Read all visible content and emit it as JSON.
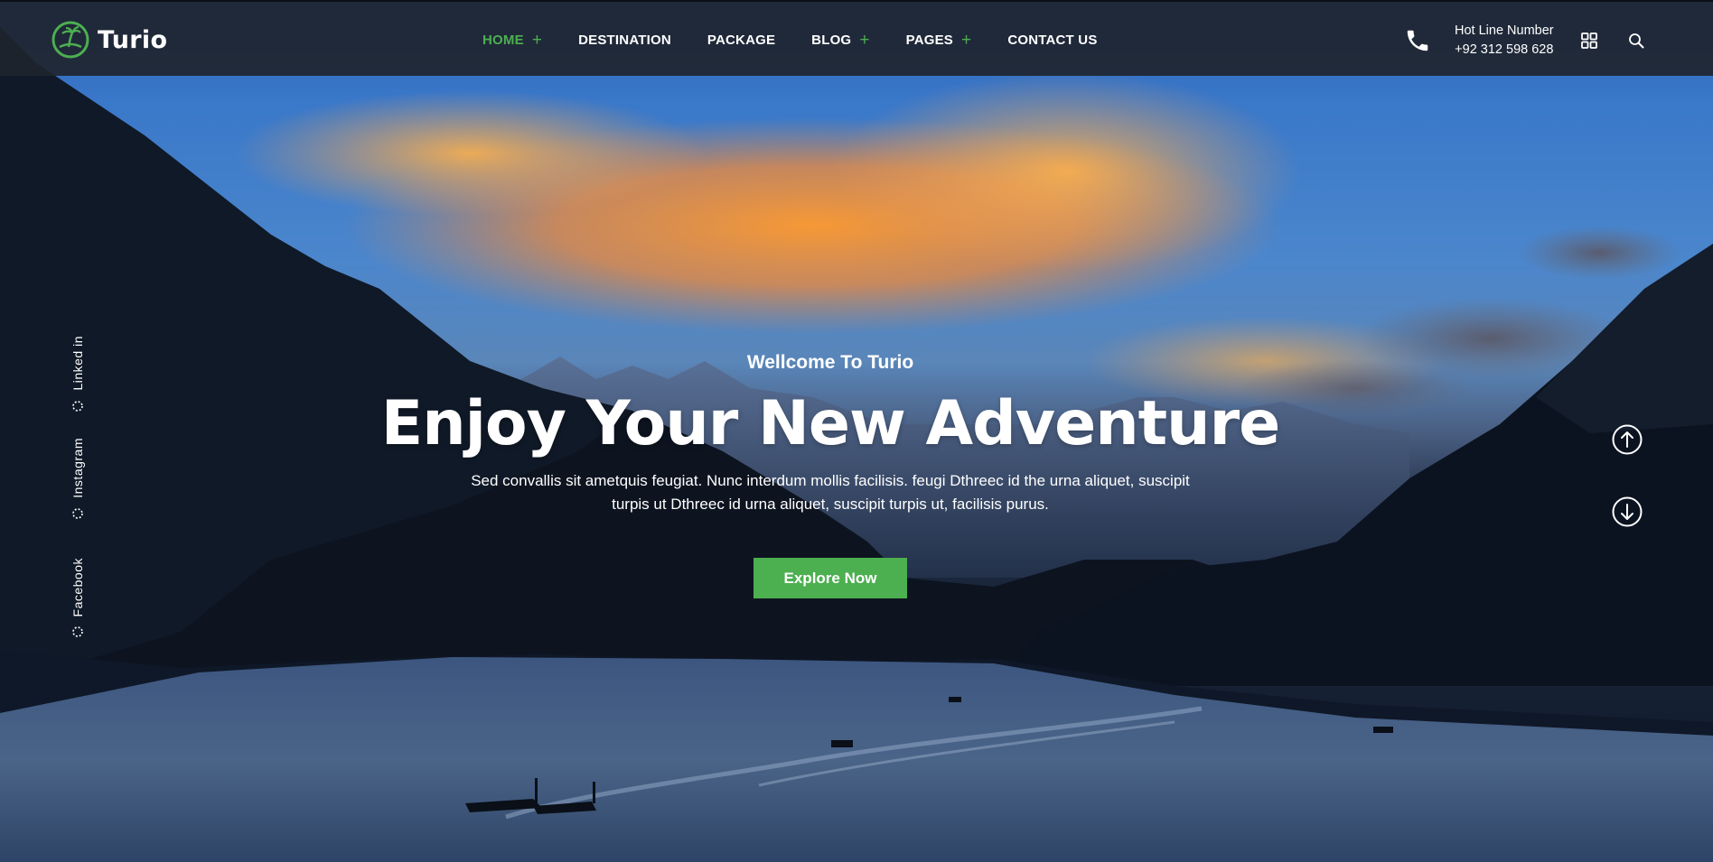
{
  "brand": {
    "name": "Turio",
    "accent": "#4caf50"
  },
  "nav": {
    "items": [
      {
        "label": "HOME",
        "has_submenu": true,
        "active": true
      },
      {
        "label": "DESTINATION",
        "has_submenu": false,
        "active": false
      },
      {
        "label": "PACKAGE",
        "has_submenu": false,
        "active": false
      },
      {
        "label": "BLOG",
        "has_submenu": true,
        "active": false
      },
      {
        "label": "PAGES",
        "has_submenu": true,
        "active": false
      },
      {
        "label": "CONTACT US",
        "has_submenu": false,
        "active": false
      }
    ],
    "submenu_glyph": "+"
  },
  "hotline": {
    "title": "Hot Line Number",
    "number": "+92 312 598 628",
    "icon": "phone-icon"
  },
  "header_icons": [
    "grid-icon",
    "search-icon"
  ],
  "social": [
    {
      "label": "Linked in"
    },
    {
      "label": "Instagram"
    },
    {
      "label": "Facebook"
    }
  ],
  "hero": {
    "welcome": "Wellcome To Turio",
    "headline": "Enjoy Your New Adventure",
    "description_line1": "Sed convallis sit ametquis feugiat. Nunc interdum mollis facilisis. feugi Dthreec id the urna aliquet, suscipit",
    "description_line2": "turpis ut Dthreec id urna aliquet, suscipit turpis ut, facilisis purus.",
    "cta_label": "Explore Now"
  },
  "slider_controls": [
    "arrow-up-icon",
    "arrow-down-icon"
  ]
}
